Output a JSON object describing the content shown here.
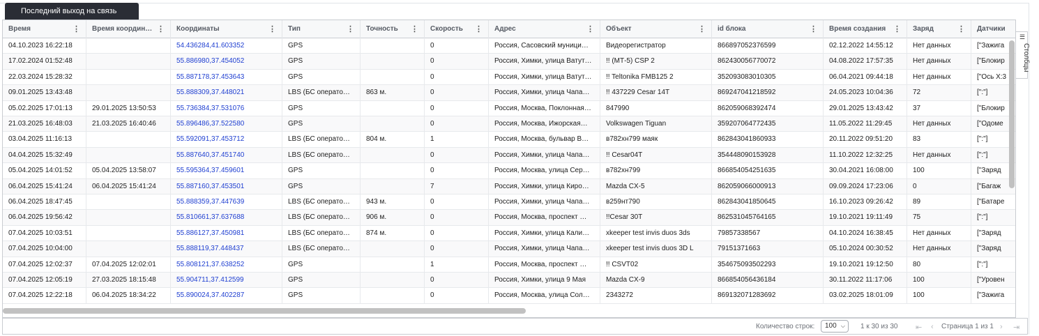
{
  "tab": {
    "label": "Последний выход на связь"
  },
  "columns": [
    "Время",
    "Время координ…",
    "Координаты",
    "Тип",
    "Точность",
    "Скорость",
    "Адрес",
    "Объект",
    "id блока",
    "Время создания",
    "Заряд",
    "Датчики"
  ],
  "rows": [
    [
      "04.10.2023 16:22:18",
      "",
      "54.436284,41.603352",
      "GPS",
      "",
      "0",
      "Россия, Сасовский муници…",
      "Видеорегистратор",
      "866897052376599",
      "02.12.2022 14:55:12",
      "Нет данных",
      "[\"Зажига"
    ],
    [
      "17.02.2024 01:52:48",
      "",
      "55.886980,37.454052",
      "GPS",
      "",
      "0",
      "Россия, Химки, улица Ватут…",
      "!! (МТ-5) CSP 2",
      "862430056770072",
      "04.08.2022 17:57:35",
      "Нет данных",
      "[\"Блокир"
    ],
    [
      "22.03.2024 15:28:32",
      "",
      "55.887178,37.453643",
      "GPS",
      "",
      "0",
      "Россия, Химки, улица Ватут…",
      "!! Teltonika FMB125 2",
      "352093083010305",
      "06.04.2021 09:44:18",
      "Нет данных",
      "[\"Ось X:3"
    ],
    [
      "09.01.2025 13:43:48",
      "",
      "55.888309,37.448021",
      "LBS (БС операто…",
      "863 м.",
      "0",
      "Россия, Химки, улица Чапа…",
      "!! 437229 Cesar 14T",
      "869247041218592",
      "24.05.2023 10:04:36",
      "72",
      "[\":\"]"
    ],
    [
      "05.02.2025 17:01:13",
      "29.01.2025 13:50:53",
      "55.736384,37.531076",
      "GPS",
      "",
      "0",
      "Россия, Москва, Поклонная…",
      "847990",
      "862059068392474",
      "29.01.2025 13:43:42",
      "37",
      "[\"Блокир"
    ],
    [
      "21.03.2025 16:48:03",
      "21.03.2025 16:40:46",
      "55.896486,37.522580",
      "GPS",
      "",
      "0",
      "Россия, Москва, Ижорская…",
      "Volkswagen Tiguan",
      "359207064772435",
      "11.05.2022 11:29:45",
      "Нет данных",
      "[\"Одоме"
    ],
    [
      "03.04.2025 11:16:13",
      "",
      "55.592091,37.453712",
      "LBS (БС операто…",
      "804 м.",
      "1",
      "Россия, Москва, бульвар В…",
      "в782хн799 маяк",
      "862843041860933",
      "20.11.2022 09:51:20",
      "83",
      "[\":\"]"
    ],
    [
      "04.04.2025 15:32:49",
      "",
      "55.887640,37.451740",
      "LBS (БС операто…",
      "",
      "0",
      "Россия, Химки, улица Чапа…",
      "!! Cesar04T",
      "354448090153928",
      "11.10.2022 12:32:25",
      "Нет данных",
      "[\":\"]"
    ],
    [
      "05.04.2025 14:01:52",
      "05.04.2025 13:58:07",
      "55.595364,37.459601",
      "GPS",
      "",
      "0",
      "Россия, Москва, улица Сер…",
      "в782хн799",
      "866854054251635",
      "30.04.2021 16:08:00",
      "100",
      "[\"Заряд"
    ],
    [
      "06.04.2025 15:41:24",
      "06.04.2025 15:41:24",
      "55.887160,37.453501",
      "GPS",
      "",
      "7",
      "Россия, Химки, улица Киро…",
      "Mazda CX-5",
      "862059066000913",
      "09.09.2024 17:23:06",
      "0",
      "[\"Багаж"
    ],
    [
      "06.04.2025 18:47:45",
      "",
      "55.888359,37.447639",
      "LBS (БС операто…",
      "943 м.",
      "0",
      "Россия, Химки, улица Чапа…",
      "в259нт790",
      "862843041850645",
      "16.10.2023 09:26:42",
      "89",
      "[\"Батаре"
    ],
    [
      "06.04.2025 19:56:42",
      "",
      "55.810661,37.637688",
      "LBS (БС операто…",
      "906 м.",
      "0",
      "Россия, Москва, проспект …",
      "!!Cesar 30T",
      "862531045764165",
      "19.10.2021 19:11:49",
      "75",
      "[\":\"]"
    ],
    [
      "07.04.2025 10:03:51",
      "",
      "55.886127,37.450981",
      "LBS (БС операто…",
      "874 м.",
      "0",
      "Россия, Химки, улица Кали…",
      "xkeeper test invis duos 3ds",
      "79857338567",
      "04.10.2024 16:38:45",
      "Нет данных",
      "[\"Заряд"
    ],
    [
      "07.04.2025 10:04:00",
      "",
      "55.888119,37.448437",
      "LBS (БС операто…",
      "",
      "0",
      "Россия, Химки, улица Чапа…",
      "xkeeper test invis duos 3D L",
      "79151371663",
      "05.10.2024 00:30:52",
      "Нет данных",
      "[\"Заряд"
    ],
    [
      "07.04.2025 12:02:37",
      "07.04.2025 12:02:01",
      "55.808121,37.638252",
      "GPS",
      "",
      "1",
      "Россия, Москва, проспект …",
      "!! CSVT02",
      "354675093502293",
      "19.10.2021 19:12:50",
      "80",
      "[\":\"]"
    ],
    [
      "07.04.2025 12:05:19",
      "27.03.2025 18:15:48",
      "55.904711,37.412599",
      "GPS",
      "",
      "0",
      "Россия, Химки, улица 9 Мая",
      "Mazda CX-9",
      "866854056436184",
      "30.11.2022 11:17:06",
      "100",
      "[\"Уровен"
    ],
    [
      "07.04.2025 12:22:18",
      "06.04.2025 18:34:22",
      "55.890024,37.402287",
      "GPS",
      "",
      "0",
      "Россия, Москва, улица Сол…",
      "2343272",
      "869132071283692",
      "03.02.2025 18:01:09",
      "100",
      "[\"Зажига"
    ]
  ],
  "side_panel": {
    "label": "Столбцы"
  },
  "footer": {
    "rows_count_label": "Количество строк:",
    "rows_count_value": "100",
    "range_text": "1 к 30 из 30",
    "page_text": "Страница 1 из 1"
  }
}
